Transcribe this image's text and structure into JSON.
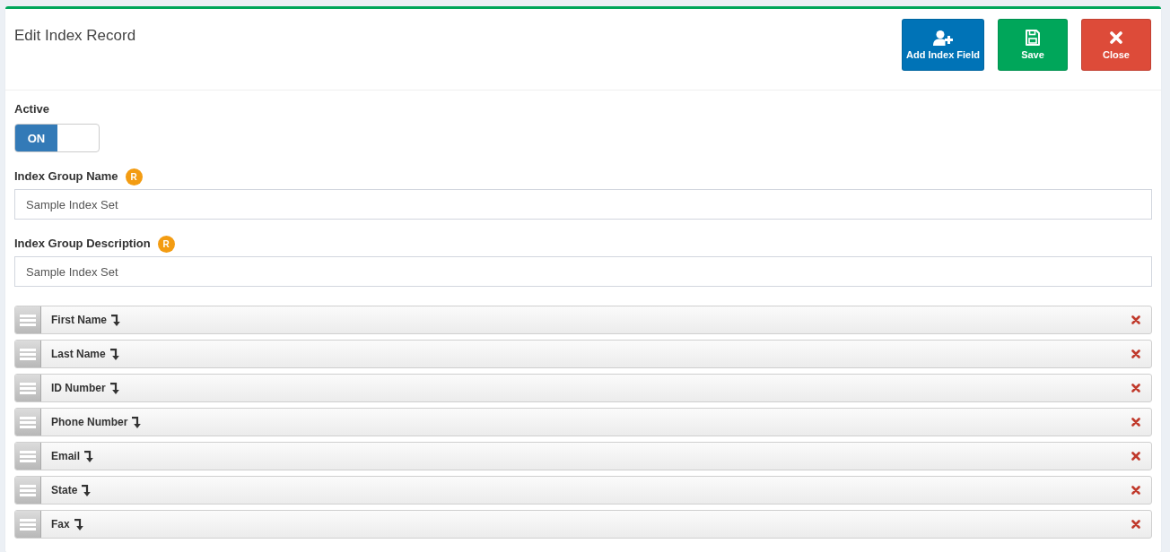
{
  "header": {
    "title": "Edit Index Record",
    "buttons": [
      {
        "kind": "add",
        "label": "Add Index Field"
      },
      {
        "kind": "save",
        "label": "Save"
      },
      {
        "kind": "close",
        "label": "Close"
      }
    ]
  },
  "active": {
    "label": "Active",
    "on": true,
    "on_text": "ON"
  },
  "text_fields": [
    {
      "label": "Index Group Name",
      "badge": "R",
      "value": "Sample Index Set"
    },
    {
      "label": "Index Group Description",
      "badge": "R",
      "value": "Sample Index Set"
    }
  ],
  "index_fields": [
    {
      "label": "First Name"
    },
    {
      "label": "Last Name"
    },
    {
      "label": "ID Number"
    },
    {
      "label": "Phone Number"
    },
    {
      "label": "Email"
    },
    {
      "label": "State"
    },
    {
      "label": "Fax"
    }
  ]
}
